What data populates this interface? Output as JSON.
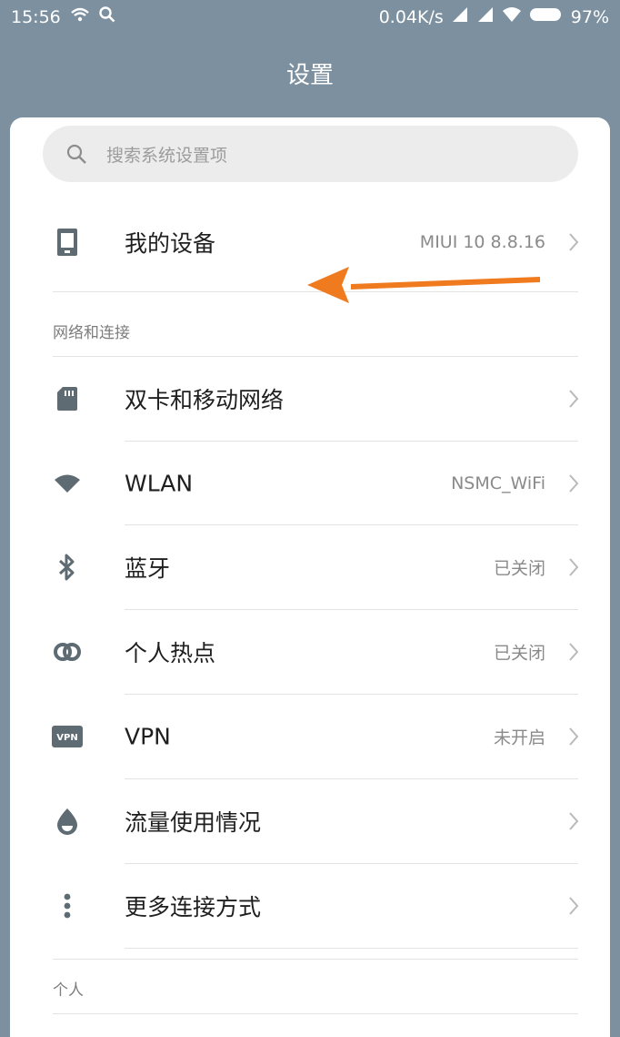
{
  "status_bar": {
    "time": "15:56",
    "network_speed": "0.04K/s",
    "battery_percent": "97%",
    "icons": [
      "wifi-hotspot-icon",
      "search-icon",
      "signal-icon",
      "signal-icon",
      "wifi-icon",
      "battery-icon"
    ]
  },
  "header": {
    "title": "设置"
  },
  "search": {
    "placeholder": "搜索系统设置项"
  },
  "my_device": {
    "label": "我的设备",
    "value": "MIUI 10 8.8.16",
    "icon": "phone-icon"
  },
  "sections": {
    "network_title": "网络和连接",
    "personal_title": "个人"
  },
  "network_items": [
    {
      "label": "双卡和移动网络",
      "value": "",
      "icon": "sim-card-icon"
    },
    {
      "label": "WLAN",
      "value": "NSMC_WiFi",
      "icon": "wifi-icon"
    },
    {
      "label": "蓝牙",
      "value": "已关闭",
      "icon": "bluetooth-icon"
    },
    {
      "label": "个人热点",
      "value": "已关闭",
      "icon": "hotspot-link-icon"
    },
    {
      "label": "VPN",
      "value": "未开启",
      "icon": "vpn-icon"
    },
    {
      "label": "流量使用情况",
      "value": "",
      "icon": "data-usage-icon"
    },
    {
      "label": "更多连接方式",
      "value": "",
      "icon": "more-dots-icon"
    }
  ],
  "colors": {
    "background": "#7c909f",
    "card": "#ffffff",
    "annotation_arrow": "#f07a1e",
    "icon_gray": "#5f6b73"
  }
}
